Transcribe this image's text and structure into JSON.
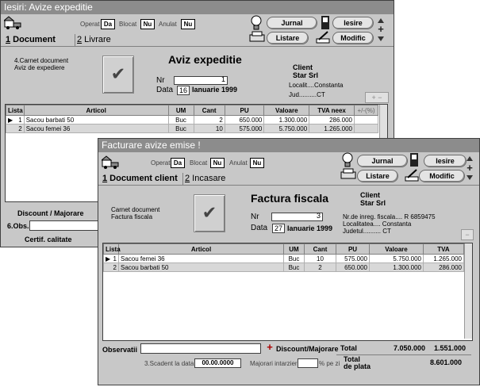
{
  "win1": {
    "title": "Iesiri: Avize expeditie",
    "flags": {
      "operat_label": "Operat",
      "operat_val": "Da",
      "blocat_label": "Blocat",
      "blocat_val": "Nu",
      "anulat_label": "Anulat",
      "anulat_val": "Nu"
    },
    "buttons": {
      "jurnal": "Jurnal",
      "listare": "Listare",
      "iesire": "Iesire",
      "modific": "Modific"
    },
    "tabs": [
      {
        "num": "1",
        "label": " Document"
      },
      {
        "num": "2",
        "label": " Livrare"
      }
    ],
    "doc_label1": "4.Carnet document",
    "doc_label2": "Aviz de expediere",
    "heading": "Aviz expeditie",
    "nr_label": "Nr",
    "nr_value": "1",
    "data_label": "Data",
    "day": "16",
    "month_year": "Ianuarie 1999",
    "client_label": "Client",
    "client_name": "Star Srl",
    "localit": "Localit....Constanta",
    "jud": "Jud..........CT",
    "columns": [
      "Lista",
      "Articol",
      "UM",
      "Cant",
      "PU",
      "Valoare",
      "TVA neex",
      "+/-(%)"
    ],
    "rows": [
      {
        "lista": "1",
        "articol": "Sacou barbati 50",
        "um": "Buc",
        "cant": "2",
        "pu": "650.000",
        "valoare": "1.300.000",
        "tva": "286.000"
      },
      {
        "lista": "2",
        "articol": "Sacou femei 36",
        "um": "Buc",
        "cant": "10",
        "pu": "575.000",
        "valoare": "5.750.000",
        "tva": "1.265.000"
      }
    ],
    "discount": "Discount / Majorare",
    "obs": "6.Obs.",
    "certif": "Certif. calitate"
  },
  "win2": {
    "title": "Facturare avize emise !",
    "flags": {
      "operat_label": "Operat",
      "operat_val": "Da",
      "blocat_label": "Blocat",
      "blocat_val": "Nu",
      "anulat_label": "Anulat",
      "anulat_val": "Nu"
    },
    "buttons": {
      "jurnal": "Jurnal",
      "listare": "Listare",
      "iesire": "Iesire",
      "modific": "Modific"
    },
    "tabs": [
      {
        "num": "1",
        "label": " Document client"
      },
      {
        "num": "2",
        "label": " Incasare"
      }
    ],
    "doc_label1": "Carnet document",
    "doc_label2": "Factura fiscala",
    "heading": "Factura fiscala",
    "nr_label": "Nr",
    "nr_value": "3",
    "data_label": "Data",
    "day": "27",
    "month_year": "Ianuarie 1999",
    "client_label": "Client",
    "client_name": "Star Srl",
    "reg": "Nr.de inreg. fiscala.... R 6859475",
    "localitatea": "Localitatea.... Constanta",
    "judetul": "Judetul.......... CT",
    "columns": [
      "Lista",
      "Articol",
      "UM",
      "Cant",
      "PU",
      "Valoare",
      "TVA"
    ],
    "rows": [
      {
        "lista": "1",
        "articol": "Sacou femei 36",
        "um": "Buc",
        "cant": "10",
        "pu": "575.000",
        "valoare": "5.750.000",
        "tva": "1.265.000"
      },
      {
        "lista": "2",
        "articol": "Sacou barbati 50",
        "um": "Buc",
        "cant": "2",
        "pu": "650.000",
        "valoare": "1.300.000",
        "tva": "286.000"
      }
    ],
    "observatii": "Observatii",
    "discount": "Discount/Majorare",
    "total_label": "Total",
    "total_valoare": "7.050.000",
    "total_tva": "1.551.000",
    "scadent_label": "3.Scadent la data",
    "scadent_value": "00.00.0000",
    "majorari": "Majorari intarziere",
    "pe_zi": "% pe zi",
    "total_plata_label": "Total\nde plata",
    "total_plata_value": "8.601.000"
  }
}
